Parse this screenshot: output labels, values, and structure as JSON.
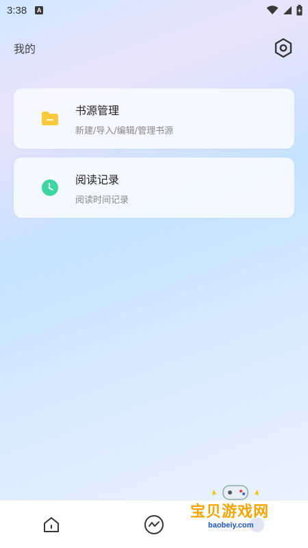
{
  "status_bar": {
    "time": "3:38",
    "notification_icon": "A"
  },
  "header": {
    "title": "我的",
    "settings_icon": "hexagon-gear-icon"
  },
  "menu": [
    {
      "title": "书源管理",
      "subtitle": "新建/导入/编辑/管理书源",
      "icon": "folder-icon",
      "icon_color": "#F9C93C"
    },
    {
      "title": "阅读记录",
      "subtitle": "阅读时间记录",
      "icon": "clock-icon",
      "icon_color": "#3DD6A0"
    }
  ],
  "bottom_nav": {
    "items": [
      {
        "icon": "home-icon"
      },
      {
        "icon": "trend-icon"
      },
      {
        "icon": "profile-icon"
      }
    ]
  },
  "watermark": {
    "text": "宝贝游戏网",
    "url": "baobeiy.com"
  }
}
